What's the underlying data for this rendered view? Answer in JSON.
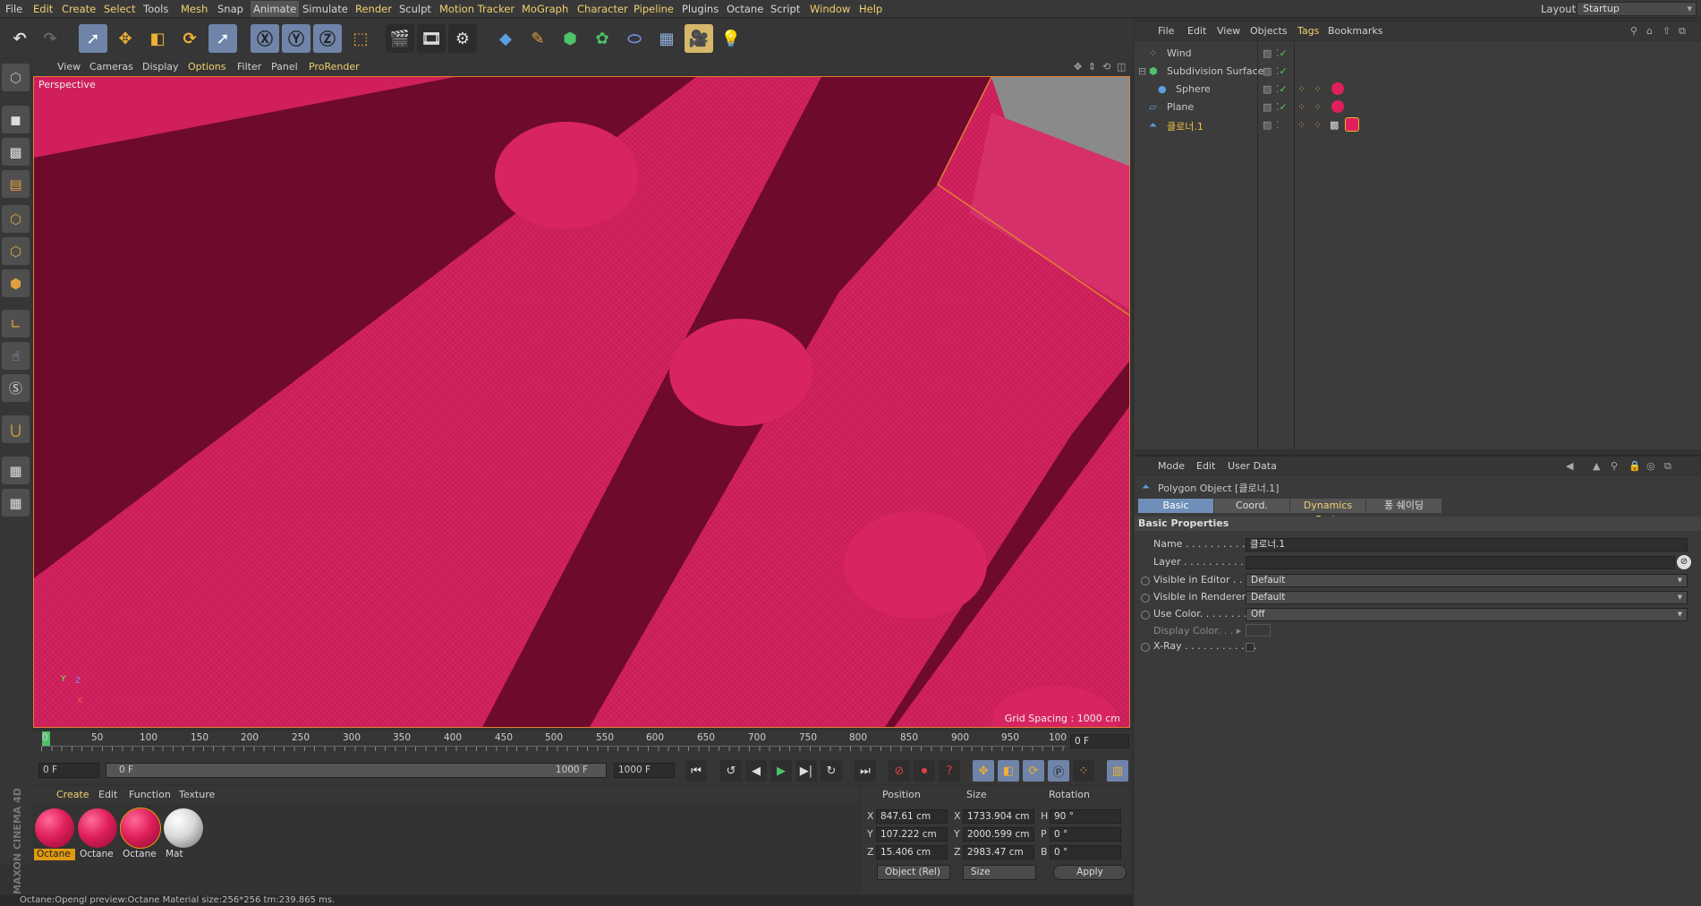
{
  "menubar": {
    "items": [
      "File",
      "Edit",
      "Create",
      "Select",
      "Tools",
      "Mesh",
      "Snap",
      "Animate",
      "Simulate",
      "Render",
      "Sculpt",
      "Motion Tracker",
      "MoGraph",
      "Character",
      "Pipeline",
      "Plugins",
      "Octane",
      "Script",
      "Window",
      "Help"
    ],
    "layout_label": "Layout:",
    "layout_value": "Startup"
  },
  "viewport": {
    "menu": [
      "View",
      "Cameras",
      "Display",
      "Options",
      "Filter",
      "Panel",
      "ProRender"
    ],
    "label": "Perspective",
    "grid_spacing": "Grid Spacing : 1000 cm",
    "axis_x": "X",
    "axis_y": "Y",
    "axis_z": "Z"
  },
  "timeline": {
    "ticks": [
      "0",
      "50",
      "100",
      "150",
      "200",
      "250",
      "300",
      "350",
      "400",
      "450",
      "500",
      "550",
      "600",
      "650",
      "700",
      "750",
      "800",
      "850",
      "900",
      "950",
      "100"
    ],
    "current_frame": "0 F",
    "start_field": "0 F",
    "range_start": "0 F",
    "range_end": "1000 F",
    "end_field": "1000 F"
  },
  "materials": {
    "menu": [
      "Create",
      "Edit",
      "Function",
      "Texture"
    ],
    "items": [
      {
        "name": "Octane",
        "color": "#e0205a",
        "selected": true
      },
      {
        "name": "Octane",
        "color": "#e0205a",
        "selected": false
      },
      {
        "name": "Octane",
        "color": "#e0205a",
        "selected": false
      },
      {
        "name": "Mat",
        "color": "#e8e8e8",
        "selected": false
      }
    ]
  },
  "coords": {
    "headers": [
      "Position",
      "Size",
      "Rotation"
    ],
    "rows": [
      {
        "axis": "X",
        "pos": "847.61 cm",
        "size_axis": "X",
        "size": "1733.904 cm",
        "rot_axis": "H",
        "rot": "90 °"
      },
      {
        "axis": "Y",
        "pos": "107.222 cm",
        "size_axis": "Y",
        "size": "2000.599 cm",
        "rot_axis": "P",
        "rot": "0 °"
      },
      {
        "axis": "Z",
        "pos": "15.406 cm",
        "size_axis": "Z",
        "size": "2983.47 cm",
        "rot_axis": "B",
        "rot": "0 °"
      }
    ],
    "mode": "Object (Rel)",
    "size_mode": "Size",
    "apply": "Apply"
  },
  "status": "Octane:Opengl preview:Octane Material  size:256*256  tm:239.865 ms.",
  "brand": "MAXON CINEMA 4D",
  "object_manager": {
    "menu": [
      "File",
      "Edit",
      "View",
      "Objects",
      "Tags",
      "Bookmarks"
    ],
    "objects": [
      {
        "name": "Wind",
        "highlight": false
      },
      {
        "name": "Subdivision Surface",
        "highlight": false
      },
      {
        "name": "Sphere",
        "highlight": false
      },
      {
        "name": "Plane",
        "highlight": false
      },
      {
        "name": "클로너.1",
        "highlight": true
      }
    ]
  },
  "attributes": {
    "menu": [
      "Mode",
      "Edit",
      "User Data"
    ],
    "title": "Polygon Object [클로너.1]",
    "tabs": [
      "Basic",
      "Coord.",
      "Dynamics Body",
      "퐁 쉐이딩"
    ],
    "section": "Basic Properties",
    "props": [
      {
        "label": "Name . . . . . . . . . . . . .",
        "value": "클로너.1",
        "type": "field"
      },
      {
        "label": "Layer . . . . . . . . . . . . .",
        "value": "",
        "type": "field"
      },
      {
        "label": "Visible in Editor . .",
        "value": "Default",
        "type": "select"
      },
      {
        "label": "Visible in Renderer",
        "value": "Default",
        "type": "select"
      },
      {
        "label": "Use Color. . . . . . . .",
        "value": "Off",
        "type": "select"
      },
      {
        "label": "Display Color. . . ▸",
        "value": "",
        "type": "color"
      },
      {
        "label": "X-Ray . . . . . . . . . . . .",
        "value": "",
        "type": "check"
      }
    ]
  }
}
